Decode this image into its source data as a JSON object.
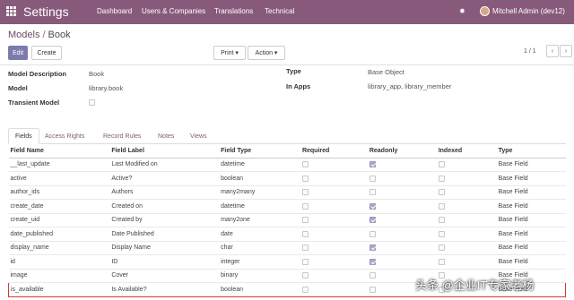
{
  "navbar": {
    "brand": "Settings",
    "menu": [
      "Dashboard",
      "Users & Companies",
      "Translations",
      "Technical"
    ],
    "bug_icon": "bug-icon",
    "user": "Mitchell Admin (dev12)",
    "bg_color": "#875a7b"
  },
  "breadcrumb": {
    "parent": "Models",
    "separator": "/",
    "current": "Book"
  },
  "buttons": {
    "edit": "Edit",
    "create": "Create",
    "print": "Print ▾",
    "action": "Action ▾"
  },
  "pager": {
    "text": "1 / 1",
    "prev": "‹",
    "next": "›"
  },
  "form": {
    "model_description": {
      "label": "Model Description",
      "value": "Book"
    },
    "model": {
      "label": "Model",
      "value": "library.book"
    },
    "transient": {
      "label": "Transient Model",
      "checked": false
    },
    "type": {
      "label": "Type",
      "value": "Base Object"
    },
    "in_apps": {
      "label": "In Apps",
      "value": "library_app, library_member"
    }
  },
  "tabs": [
    "Fields",
    "Access Rights",
    "Record Rules",
    "Notes",
    "Views"
  ],
  "table": {
    "headers": [
      "Field Name",
      "Field Label",
      "Field Type",
      "Required",
      "Readonly",
      "Indexed",
      "Type"
    ],
    "rows": [
      {
        "name": "__last_update",
        "label": "Last Modified on",
        "ftype": "datetime",
        "required": false,
        "readonly": true,
        "indexed": false,
        "type": "Base Field"
      },
      {
        "name": "active",
        "label": "Active?",
        "ftype": "boolean",
        "required": false,
        "readonly": false,
        "indexed": false,
        "type": "Base Field"
      },
      {
        "name": "author_ids",
        "label": "Authors",
        "ftype": "many2many",
        "required": false,
        "readonly": false,
        "indexed": false,
        "type": "Base Field"
      },
      {
        "name": "create_date",
        "label": "Created on",
        "ftype": "datetime",
        "required": false,
        "readonly": true,
        "indexed": false,
        "type": "Base Field"
      },
      {
        "name": "create_uid",
        "label": "Created by",
        "ftype": "many2one",
        "required": false,
        "readonly": true,
        "indexed": false,
        "type": "Base Field"
      },
      {
        "name": "date_published",
        "label": "Date Published",
        "ftype": "date",
        "required": false,
        "readonly": false,
        "indexed": false,
        "type": "Base Field"
      },
      {
        "name": "display_name",
        "label": "Display Name",
        "ftype": "char",
        "required": false,
        "readonly": true,
        "indexed": false,
        "type": "Base Field"
      },
      {
        "name": "id",
        "label": "ID",
        "ftype": "integer",
        "required": false,
        "readonly": true,
        "indexed": false,
        "type": "Base Field"
      },
      {
        "name": "image",
        "label": "Cover",
        "ftype": "binary",
        "required": false,
        "readonly": false,
        "indexed": false,
        "type": "Base Field"
      },
      {
        "name": "is_available",
        "label": "Is Available?",
        "ftype": "boolean",
        "required": false,
        "readonly": false,
        "indexed": false,
        "type": "Base Field"
      }
    ]
  },
  "watermark": "头条 @企业IT专家老杨"
}
